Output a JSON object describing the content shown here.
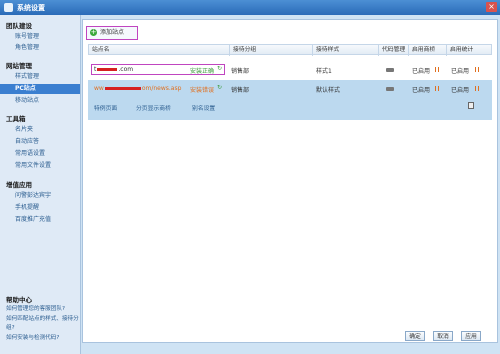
{
  "window": {
    "title": "系统设置",
    "close_label": "×"
  },
  "sidebar": {
    "sections": [
      {
        "title": "团队建设",
        "items": [
          "账号管理",
          "角色管理"
        ]
      },
      {
        "title": "网站管理",
        "items": [
          "样式管理",
          "PC站点",
          "移动站点"
        ]
      },
      {
        "title": "工具箱",
        "items": [
          "名片夹",
          "自动应答",
          "常用语设置",
          "常用文件设置"
        ]
      },
      {
        "title": "增值应用",
        "items": [
          "问警彭达宾宇",
          "手机提醒",
          "百度推广充值"
        ]
      }
    ],
    "active_item": "PC站点",
    "help": {
      "title": "帮助中心",
      "links": [
        "如何管理您的客服团队?",
        "如何匹配站点的样式、接待分组?",
        "如何安装与检测代码?"
      ]
    }
  },
  "toolbar": {
    "add_site_label": "添加站点"
  },
  "table": {
    "columns": [
      "站点名",
      "接待分组",
      "接待样式",
      "代码管理",
      "启用商桥",
      "启用统计"
    ],
    "rows": [
      {
        "site_prefix": "t",
        "site_suffix": ".com",
        "status": "安装正确",
        "status_type": "ok",
        "group": "销售部",
        "style": "样式1",
        "bridge": "已启用",
        "stats": "已启用"
      },
      {
        "site_prefix": "ww",
        "site_suffix": "om/news.asp",
        "status": "安装错误",
        "status_type": "error",
        "group": "销售部",
        "style": "默认样式",
        "bridge": "已启用",
        "stats": "已启用",
        "sublinks": [
          "特例页面",
          "分页显示商桥",
          "别名设置"
        ]
      }
    ]
  },
  "footer": {
    "buttons": [
      "确定",
      "取消",
      "应用"
    ]
  },
  "colors": {
    "accent": "#3b7fd0",
    "highlight_border": "#c045c0",
    "ok": "#3a9a3a",
    "error": "#e07020",
    "redacted": "#d62020"
  }
}
